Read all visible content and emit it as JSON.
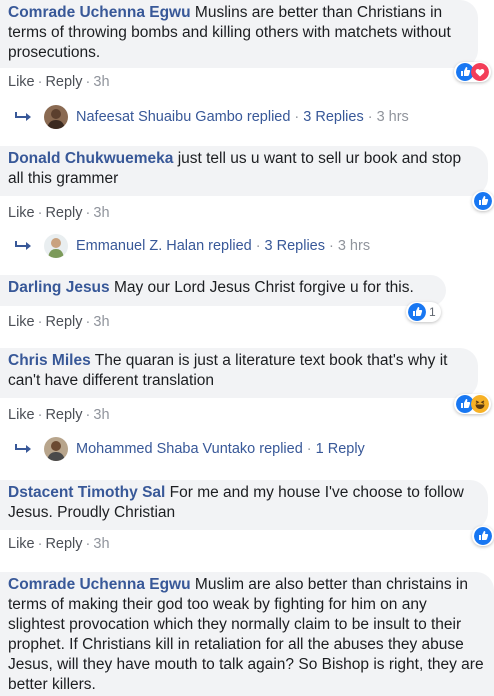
{
  "actions": {
    "like": "Like",
    "reply": "Reply",
    "separator": "·"
  },
  "colors": {
    "author": "#385898",
    "bubble": "#f2f3f5",
    "like_blue": "#1877f2",
    "love_red": "#f33e58",
    "haha_yellow": "#f7b125"
  },
  "comments": [
    {
      "author": "Comrade Uchenna Egwu",
      "text": "Muslins are better than Christians in terms of throwing bombs and killing others with matchets without prosecutions.",
      "time": "3h",
      "reactions": [
        "like-icon",
        "love-icon"
      ],
      "replies": {
        "name": "Nafeesat Shuaibu Gambo replied",
        "count": "3 Replies",
        "time": "3 hrs"
      }
    },
    {
      "author": "Donald Chukwuemeka",
      "text": "just tell us u want to sell ur book and stop all this grammer",
      "time": "3h",
      "reactions": [
        "like-icon"
      ],
      "replies": {
        "name": "Emmanuel Z. Halan replied",
        "count": "3 Replies",
        "time": "3 hrs"
      }
    },
    {
      "author": "Darling Jesus",
      "text": "May our Lord Jesus Christ forgive u for this.",
      "time": "3h",
      "reactions": [
        "like-icon"
      ],
      "reaction_count": "1"
    },
    {
      "author": "Chris Miles",
      "text": "The quaran is just a literature text book that's why it can't have different translation",
      "time": "3h",
      "reactions": [
        "like-icon",
        "haha-icon"
      ],
      "replies": {
        "name": "Mohammed Shaba Vuntako replied",
        "count": "1 Reply",
        "time": ""
      }
    },
    {
      "author": "Dstacent Timothy Sal",
      "text": "For me and my house I've choose to follow Jesus. Proudly Christian",
      "time": "3h",
      "reactions": [
        "like-icon"
      ]
    },
    {
      "author": "Comrade Uchenna Egwu",
      "text": "Muslim are also better than christains in terms of making their god too weak by fighting for him on any slightest provocation which they normally claim to be insult to their prophet. If Christians kill in retaliation for all the abuses they abuse Jesus, will they have mouth to talk again? So Bishop is right, they are better killers.",
      "time": "",
      "reactions": []
    }
  ]
}
